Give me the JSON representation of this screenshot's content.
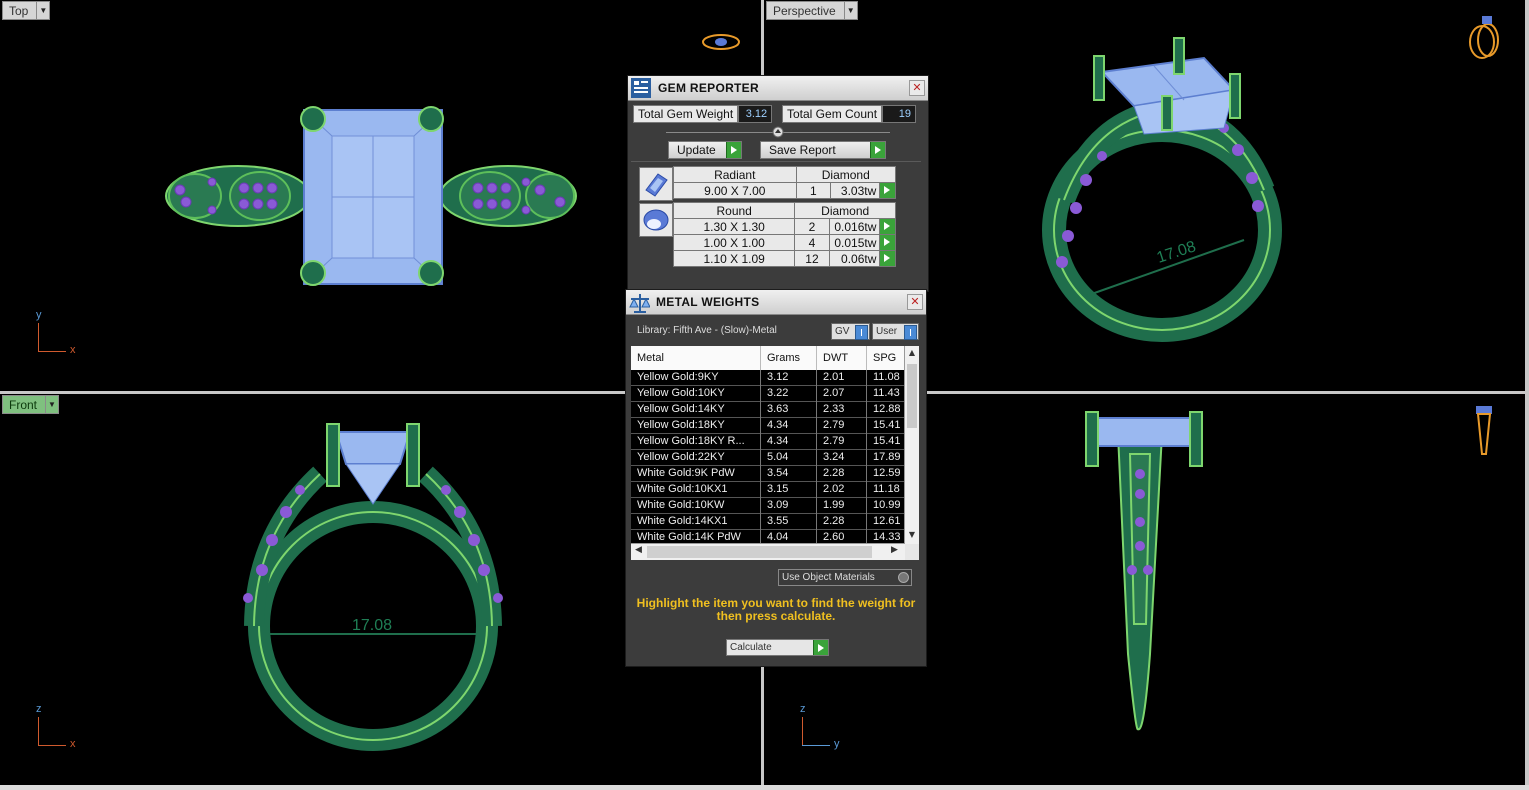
{
  "viewports": {
    "top": {
      "label": "Top",
      "axis_v": "y",
      "axis_h": "x"
    },
    "perspective": {
      "label": "Perspective",
      "measure": "17.08"
    },
    "front": {
      "label": "Front",
      "measure": "17.08",
      "axis_v": "z",
      "axis_h": "x"
    },
    "right": {
      "label": "",
      "axis_v": "z",
      "axis_h": "y"
    }
  },
  "gem_reporter": {
    "title": "GEM REPORTER",
    "total_weight_label": "Total Gem Weight",
    "total_weight_value": "3.12",
    "total_count_label": "Total Gem Count",
    "total_count_value": "19",
    "update_label": "Update",
    "save_label": "Save Report",
    "groups": [
      {
        "shape": "Radiant",
        "material": "Diamond",
        "rows": [
          {
            "size": "9.00 X 7.00",
            "qty": "1",
            "weight": "3.03tw"
          }
        ]
      },
      {
        "shape": "Round",
        "material": "Diamond",
        "rows": [
          {
            "size": "1.30 X 1.30",
            "qty": "2",
            "weight": "0.016tw"
          },
          {
            "size": "1.00 X 1.00",
            "qty": "4",
            "weight": "0.015tw"
          },
          {
            "size": "1.10 X 1.09",
            "qty": "12",
            "weight": "0.06tw"
          }
        ]
      }
    ]
  },
  "metal_weights": {
    "title": "METAL WEIGHTS",
    "library": "Library: Fifth Ave - (Slow)-Metal",
    "toggle_gv": "GV",
    "toggle_user": "User",
    "columns": [
      "Metal",
      "Grams",
      "DWT",
      "SPG"
    ],
    "rows": [
      [
        "Yellow Gold:9KY",
        "3.12",
        "2.01",
        "11.08"
      ],
      [
        "Yellow Gold:10KY",
        "3.22",
        "2.07",
        "11.43"
      ],
      [
        "Yellow Gold:14KY",
        "3.63",
        "2.33",
        "12.88"
      ],
      [
        "Yellow Gold:18KY",
        "4.34",
        "2.79",
        "15.41"
      ],
      [
        "Yellow Gold:18KY R...",
        "4.34",
        "2.79",
        "15.41"
      ],
      [
        "Yellow Gold:22KY",
        "5.04",
        "3.24",
        "17.89"
      ],
      [
        "White Gold:9K PdW",
        "3.54",
        "2.28",
        "12.59"
      ],
      [
        "White Gold:10KX1",
        "3.15",
        "2.02",
        "11.18"
      ],
      [
        "White Gold:10KW",
        "3.09",
        "1.99",
        "10.99"
      ],
      [
        "White Gold:14KX1",
        "3.55",
        "2.28",
        "12.61"
      ],
      [
        "White Gold:14K PdW",
        "4.04",
        "2.60",
        "14.33"
      ]
    ],
    "use_object_materials": "Use Object Materials",
    "hint": "Highlight the item you want to find the weight for then press calculate.",
    "calculate_label": "Calculate"
  }
}
